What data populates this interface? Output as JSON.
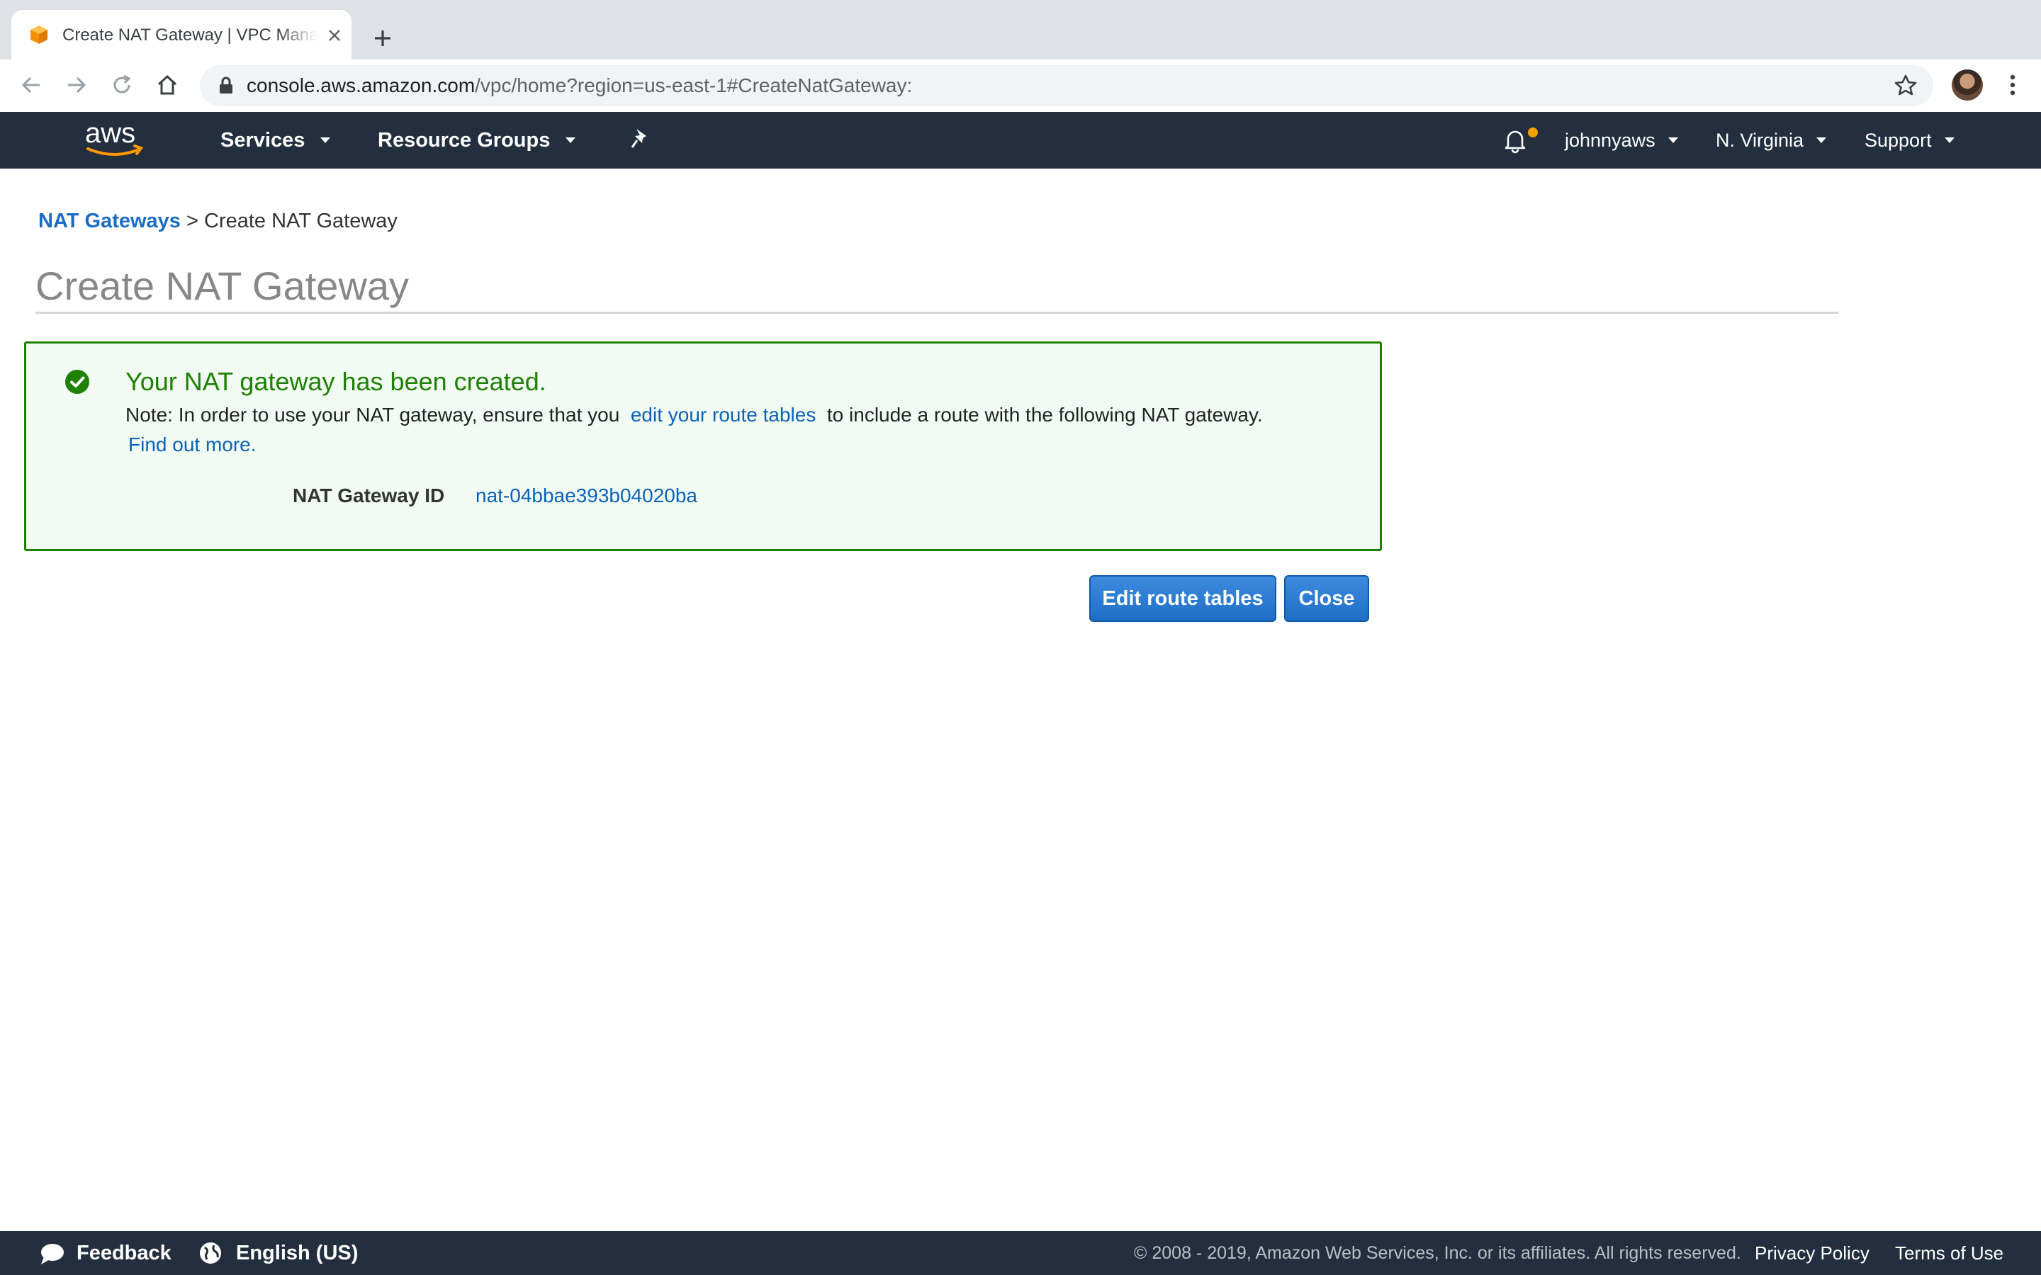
{
  "browser": {
    "tab_title": "Create NAT Gateway | VPC Management Console",
    "url_host": "console.aws.amazon.com",
    "url_path": "/vpc/home?region=us-east-1#CreateNatGateway:"
  },
  "aws_nav": {
    "logo_text": "aws",
    "services": "Services",
    "resource_groups": "Resource Groups",
    "account": "johnnyaws",
    "region": "N. Virginia",
    "support": "Support"
  },
  "breadcrumb": {
    "parent": "NAT Gateways",
    "separator": ">",
    "current": "Create NAT Gateway"
  },
  "page": {
    "title": "Create NAT Gateway"
  },
  "alert": {
    "title": "Your NAT gateway has been created.",
    "note_before": "Note: In order to use your NAT gateway, ensure that you",
    "note_link": "edit your route tables",
    "note_after": "to include a route with the following NAT gateway.",
    "find_out_more": "Find out more.",
    "gateway_id_label": "NAT Gateway ID",
    "gateway_id_value": "nat-04bbae393b04020ba"
  },
  "actions": {
    "edit_route_tables": "Edit route tables",
    "close": "Close"
  },
  "footer": {
    "feedback": "Feedback",
    "language": "English (US)",
    "copyright": "© 2008 - 2019, Amazon Web Services, Inc. or its affiliates. All rights reserved.",
    "privacy_policy": "Privacy Policy",
    "terms_of_use": "Terms of Use"
  },
  "colors": {
    "aws_nav_bg": "#232f3e",
    "aws_orange": "#ff9900",
    "success_green": "#1d8102",
    "link_blue": "#0b62b8",
    "button_blue": "#1f6ec6"
  }
}
